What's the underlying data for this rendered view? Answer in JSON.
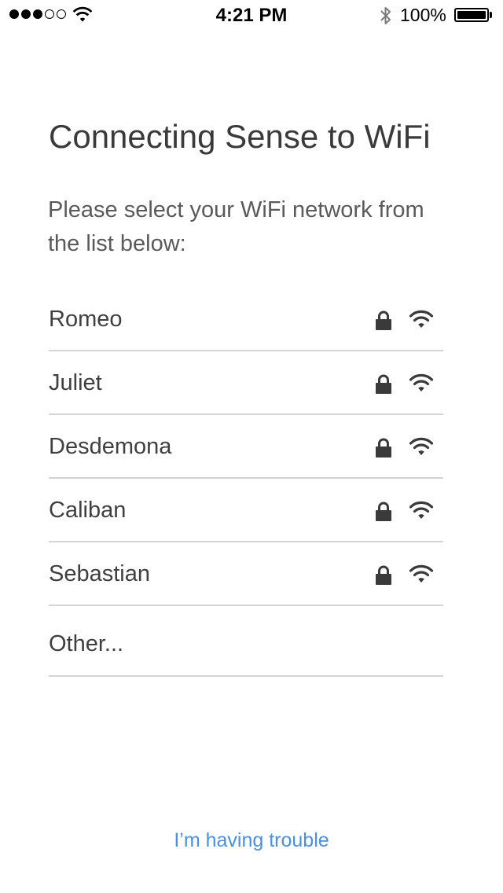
{
  "status_bar": {
    "time": "4:21 PM",
    "battery_percent_label": "100%",
    "battery_level": 1.0,
    "signal_strength": 3,
    "signal_max": 5
  },
  "title": "Connecting Sense to WiFi",
  "subtitle": "Please select your WiFi network from the list below:",
  "networks": [
    {
      "name": "Romeo",
      "secured": true,
      "icon": "wifi-icon"
    },
    {
      "name": "Juliet",
      "secured": true,
      "icon": "wifi-icon"
    },
    {
      "name": "Desdemona",
      "secured": true,
      "icon": "wifi-icon"
    },
    {
      "name": "Caliban",
      "secured": true,
      "icon": "wifi-icon"
    },
    {
      "name": "Sebastian",
      "secured": true,
      "icon": "wifi-icon"
    }
  ],
  "other_label": "Other...",
  "trouble_link": "I’m having trouble",
  "colors": {
    "link": "#4a90e2",
    "text": "#3f3f3f",
    "divider": "#d4d4d4"
  }
}
